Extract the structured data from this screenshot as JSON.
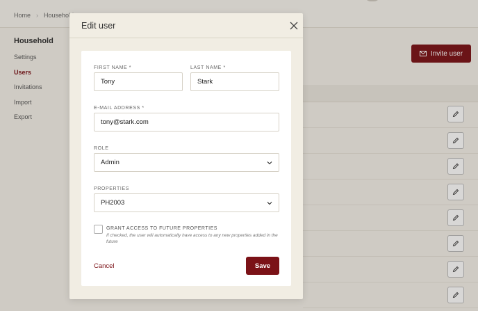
{
  "breadcrumb": {
    "home": "Home",
    "current": "Household"
  },
  "sidebar": {
    "title": "Household",
    "items": [
      {
        "label": "Settings"
      },
      {
        "label": "Users",
        "active": true
      },
      {
        "label": "Invitations"
      },
      {
        "label": "Import"
      },
      {
        "label": "Export"
      }
    ]
  },
  "page": {
    "invite_label": "Invite user"
  },
  "modal": {
    "title": "Edit user",
    "first_name": {
      "label": "FIRST NAME *",
      "value": "Tony"
    },
    "last_name": {
      "label": "LAST NAME *",
      "value": "Stark"
    },
    "email": {
      "label": "E-MAIL ADDRESS *",
      "value": "tony@stark.com"
    },
    "role": {
      "label": "ROLE",
      "value": "Admin"
    },
    "properties": {
      "label": "PROPERTIES",
      "value": "PH2003"
    },
    "future_access": {
      "label": "GRANT ACCESS TO FUTURE PROPERTIES",
      "help": "If checked, the user will automatically have access to any new properties added in the future",
      "checked": false
    },
    "cancel_label": "Cancel",
    "save_label": "Save"
  },
  "colors": {
    "accent": "#7b1217",
    "modal_bg": "#f1ede3",
    "page_bg": "#f4f1ea"
  }
}
